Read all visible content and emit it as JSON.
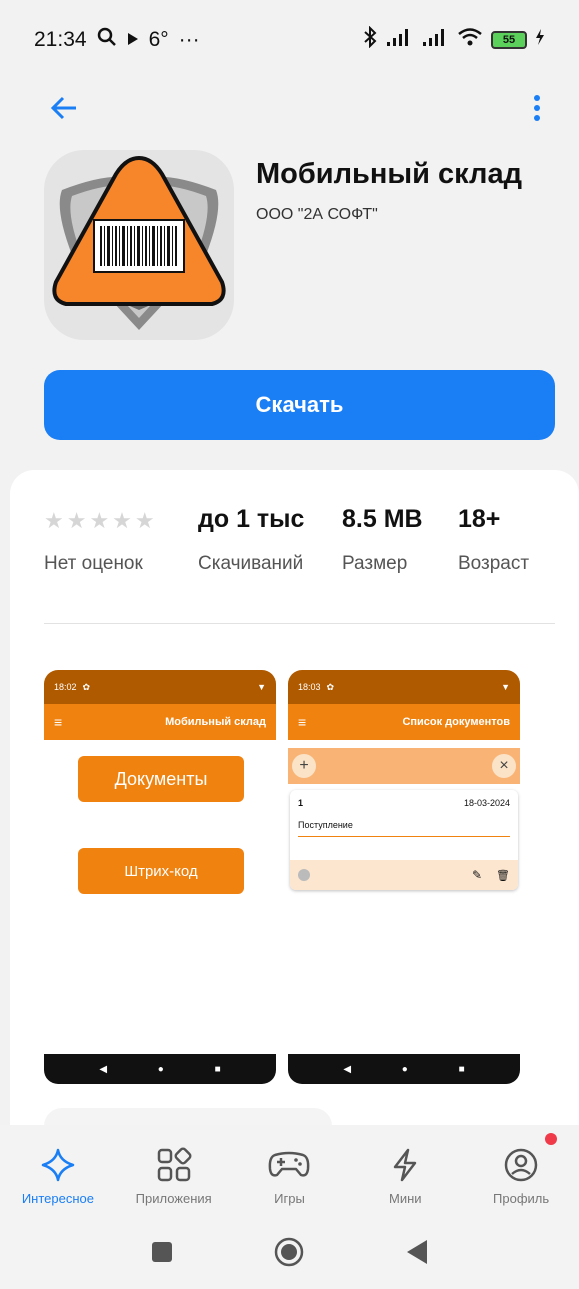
{
  "status_bar": {
    "time": "21:34",
    "temperature": "6°",
    "more": "···",
    "battery": "55"
  },
  "app": {
    "title": "Мобильный склад",
    "developer": "ООО \"2А СОФТ\"",
    "download_label": "Скачать"
  },
  "stats": {
    "rating_label": "Нет оценок",
    "downloads_value": "до 1 тыс",
    "downloads_label": "Скачиваний",
    "size_value": "8.5 MB",
    "size_label": "Размер",
    "age_value": "18+",
    "age_label": "Возраст"
  },
  "screenshots": [
    {
      "time": "18:02",
      "header_title": "Мобильный склад",
      "buttons": [
        "Документы",
        "Штрих-код"
      ]
    },
    {
      "time": "18:03",
      "header_title": "Список документов",
      "doc_number": "1",
      "doc_date": "18-03-2024",
      "doc_type": "Поступление"
    }
  ],
  "bottom_nav": [
    {
      "label": "Интересное",
      "icon": "sparkle-icon",
      "active": true
    },
    {
      "label": "Приложения",
      "icon": "apps-grid-icon",
      "active": false
    },
    {
      "label": "Игры",
      "icon": "gamepad-icon",
      "active": false
    },
    {
      "label": "Мини",
      "icon": "lightning-icon",
      "active": false
    },
    {
      "label": "Профиль",
      "icon": "profile-icon",
      "active": false
    }
  ],
  "colors": {
    "accent": "#1a7ef5",
    "orange": "#f0820f",
    "dark_orange": "#b05a00",
    "notification": "#f03a4a"
  }
}
